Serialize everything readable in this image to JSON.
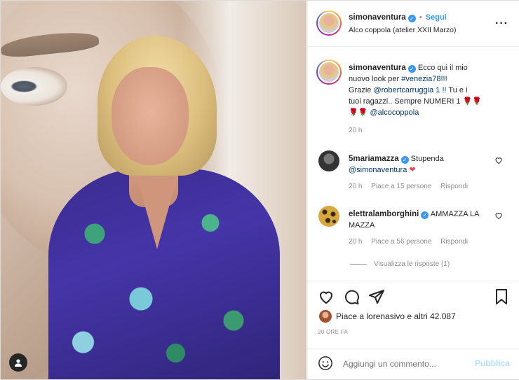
{
  "header": {
    "username": "simonaventura",
    "follow_label": "Segui",
    "location": "Alco coppola (atelier XXII Marzo)"
  },
  "caption": {
    "username": "simonaventura",
    "line1": "Ecco qui il mio",
    "line2": "nuovo look per ",
    "hashtag": "#venezia78!!!",
    "line3_prefix": "Grazie ",
    "mention1": "@robertcarruggia 1 !!",
    "line3_suffix": " Tu e i",
    "line4": "tuoi ragazzi.. Sempre NUMERI 1 🌹🌹",
    "mention2": "@alcocoppola",
    "time": "20 h"
  },
  "comments": [
    {
      "username": "5mariamazza",
      "text": "Stupenda",
      "mention": "@simonaventura",
      "emoji": "❤",
      "time": "20 h",
      "likes": "Piace a 15 persone",
      "reply": "Rispondi"
    },
    {
      "username": "elettralamborghini",
      "text": "AMMAZZA LA MAZZA",
      "time": "20 h",
      "likes": "Piace a 56 persone",
      "reply": "Rispondi",
      "view_replies": "Visualizza le risposte (1)"
    }
  ],
  "likes_line": "Piace a lorenasivo e altri 42.087",
  "post_time": "20 ORE FA",
  "comment_input": {
    "placeholder": "Aggiungi un commento...",
    "publish": "Pubblica"
  },
  "colors": {
    "blue": "#3897f0",
    "link": "#00376b",
    "muted": "#8e8e8e"
  },
  "icons": [
    "more-icon",
    "heart-icon",
    "comment-icon",
    "share-icon",
    "bookmark-icon",
    "emoji-icon",
    "user-tag-icon"
  ]
}
